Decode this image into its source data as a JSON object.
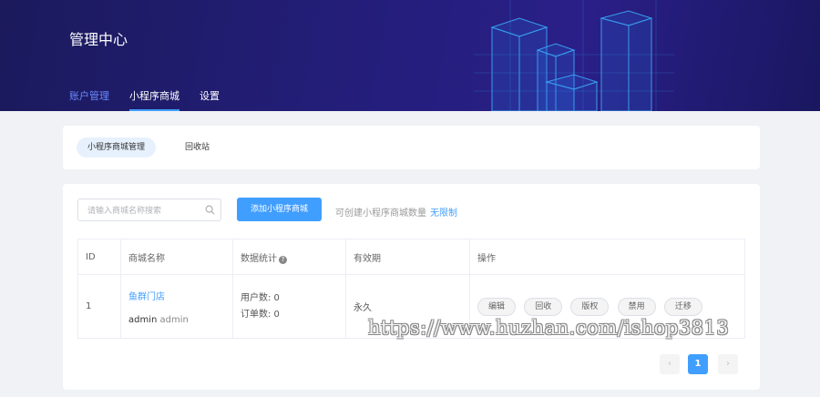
{
  "header": {
    "title": "管理中心",
    "nav": [
      {
        "label": "账户管理"
      },
      {
        "label": "小程序商城"
      },
      {
        "label": "设置"
      }
    ]
  },
  "sub_tabs": [
    {
      "label": "小程序商城管理",
      "active": true
    },
    {
      "label": "回收站",
      "active": false
    }
  ],
  "toolbar": {
    "search_placeholder": "请输入商城名称搜索",
    "add_label": "添加小程序商城",
    "quota_label": "可创建小程序商城数量",
    "quota_value": "无限制"
  },
  "table": {
    "columns": [
      "ID",
      "商城名称",
      "数据统计",
      "有效期",
      "操作"
    ],
    "rows": [
      {
        "id": "1",
        "name": "鱼群门店",
        "owner_a": "admin",
        "owner_b": "admin",
        "users": "用户数: 0",
        "orders": "订单数: 0",
        "validity": "永久",
        "actions": [
          "编辑",
          "回收",
          "版权",
          "禁用",
          "迁移"
        ]
      }
    ]
  },
  "pagination": {
    "prev": "‹",
    "current": "1",
    "next": "›"
  },
  "watermark": "https://www.huzhan.com/ishop3813",
  "colors": {
    "accent": "#409eff",
    "header_bg": "#231e78"
  }
}
